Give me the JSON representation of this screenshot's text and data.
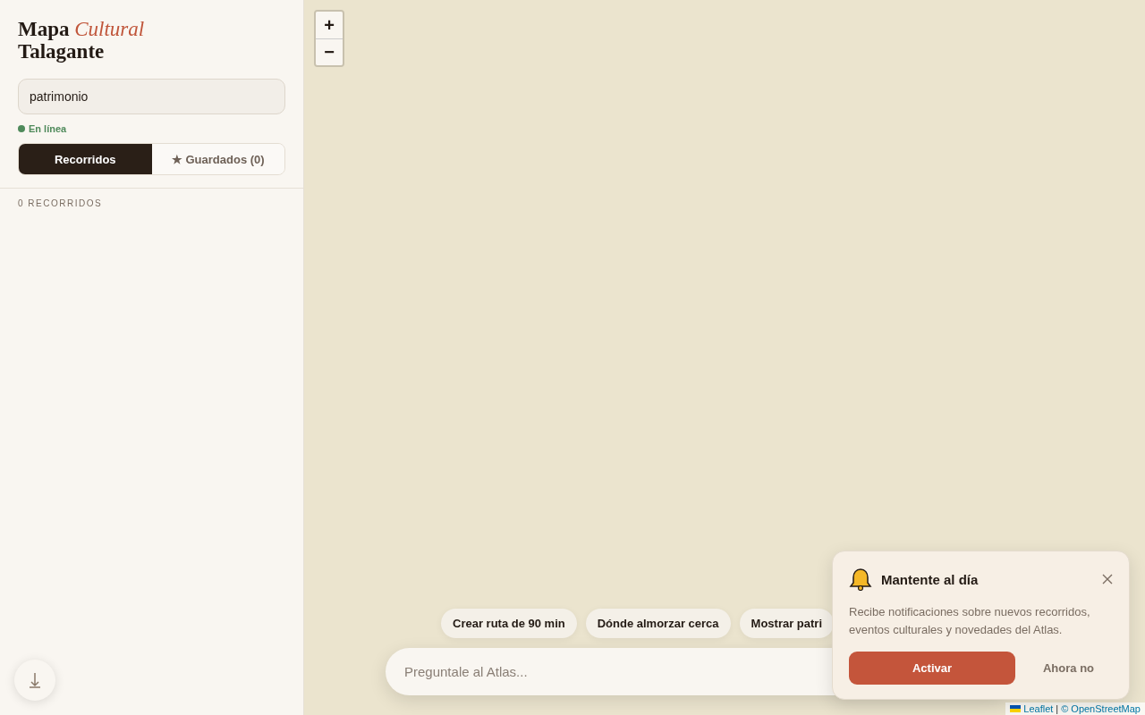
{
  "sidebar": {
    "title_line_1": "Mapa *Cultural*",
    "title_line_2": "Talagante",
    "search": {
      "value": "patrimonio"
    },
    "status": {
      "label": "En línea",
      "color": "#4f8a5b"
    },
    "tabs": [
      {
        "label": "Recorridos",
        "selected": true
      },
      {
        "label": "★ Guardados (0)",
        "selected": false
      }
    ],
    "count": "0 RECORRIDOS"
  },
  "map": {
    "zoom_in": "+",
    "zoom_out": "−",
    "chips": [
      "Crear ruta de 90 min",
      "Dónde almorzar cerca",
      "Mostrar patri"
    ],
    "chat": {
      "placeholder": "Preguntale al Atlas..."
    },
    "attribution": {
      "leaflet": "Leaflet",
      "separator": "|",
      "osm": "© OpenStreetMap"
    }
  },
  "notification": {
    "title": "Mantente al día",
    "body": "Recibe notificaciones sobre nuevos recorridos, eventos culturales y novedades del Atlas.",
    "buttons": [
      "Activar",
      "Ahora no"
    ]
  }
}
